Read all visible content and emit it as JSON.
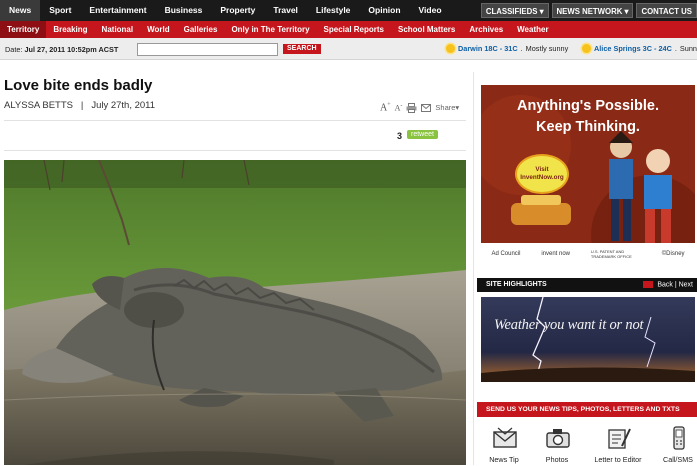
{
  "top_nav": {
    "items": [
      "News",
      "Sport",
      "Entertainment",
      "Business",
      "Property",
      "Travel",
      "Lifestyle",
      "Opinion",
      "Video"
    ],
    "right_buttons": [
      "CLASSIFIEDS",
      "NEWS NETWORK",
      "CONTACT US"
    ]
  },
  "sub_nav": {
    "items": [
      "Territory",
      "Breaking",
      "National",
      "World",
      "Galleries",
      "Only in The Territory",
      "Special Reports",
      "School Matters",
      "Archives",
      "Weather"
    ]
  },
  "date_bar": {
    "date_label": "Date:",
    "date_value": "Jul 27, 2011",
    "time_value": "10:52pm ACST",
    "search_button": "SEARCH",
    "weather": [
      {
        "city": "Darwin 18C - 31C",
        "desc": "Mostly sunny"
      },
      {
        "city": "Alice Springs 3C - 24C",
        "desc": "Sunn"
      }
    ]
  },
  "article": {
    "headline": "Love bite ends badly",
    "author": "ALYSSA BETTS",
    "date": "July 27th, 2011",
    "share_label": "Share",
    "retweet_count": "3",
    "retweet_label": "retweet"
  },
  "ad": {
    "line1": "Anything's Possible.",
    "line2": "Keep Thinking.",
    "visit_line1": "Visit",
    "visit_line2": "InventNow.org",
    "footer_items": [
      "Ad Council",
      "invent now",
      "U.S. PATENT AND TRADEMARK OFFICE",
      "©Disney"
    ]
  },
  "site_highlights": {
    "title": "SITE HIGHLIGHTS",
    "back_label": "Back",
    "next_label": "Next",
    "caption": "Weather you want it or not"
  },
  "send_bar": {
    "title": "SEND US YOUR NEWS TIPS, PHOTOS, LETTERS AND TXTS"
  },
  "contact_items": [
    "News Tip",
    "Photos",
    "Letter to Editor",
    "Call/SMS"
  ],
  "colors": {
    "nav_black": "#1a1a1a",
    "brand_red": "#c4161c",
    "retweet_green": "#8ac33f",
    "weather_blue": "#0d5fa5"
  }
}
